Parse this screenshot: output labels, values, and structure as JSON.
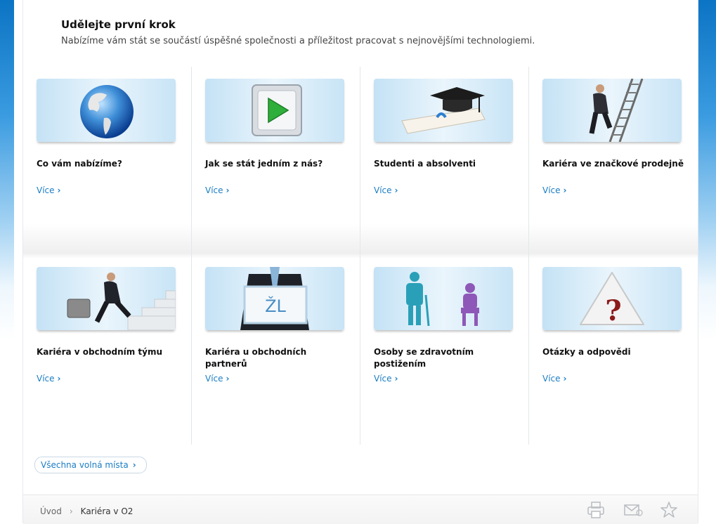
{
  "header": {
    "title": "Udělejte první krok",
    "subtitle": "Nabízíme vám stát se součástí úspěšné společnosti a příležitost pracovat s nejnovějšími technologiemi."
  },
  "cards": [
    {
      "title": "Co vám nabízíme?",
      "more": "Více",
      "image": "globe-image"
    },
    {
      "title": "Jak se stát jedním z nás?",
      "more": "Více",
      "image": "play-button-image"
    },
    {
      "title": "Studenti a absolventi",
      "more": "Více",
      "image": "graduation-cap-image"
    },
    {
      "title": "Kariéra ve značkové prodejně",
      "more": "Více",
      "image": "ladder-man-image"
    },
    {
      "title": "Kariéra v obchodním týmu",
      "more": "Více",
      "image": "businessman-stairs-image"
    },
    {
      "title": "Kariéra u obchodních partnerů",
      "more": "Více",
      "image": "zl-sign-image",
      "sign_text": "ŽL"
    },
    {
      "title": "Osoby se zdravotním postižením",
      "more": "Více",
      "image": "disabled-people-image"
    },
    {
      "title": "Otázky a odpovědi",
      "more": "Více",
      "image": "question-mark-image",
      "symbol": "?"
    }
  ],
  "all_jobs_button": "Všechna volná místa",
  "breadcrumb": {
    "home": "Úvod",
    "separator": "›",
    "current": "Kariéra v O2"
  },
  "footer_icons": [
    "print-icon",
    "email-icon",
    "favorite-star-icon"
  ],
  "colors": {
    "accent": "#1a7dc3",
    "side_blue": "#0b74c4"
  }
}
